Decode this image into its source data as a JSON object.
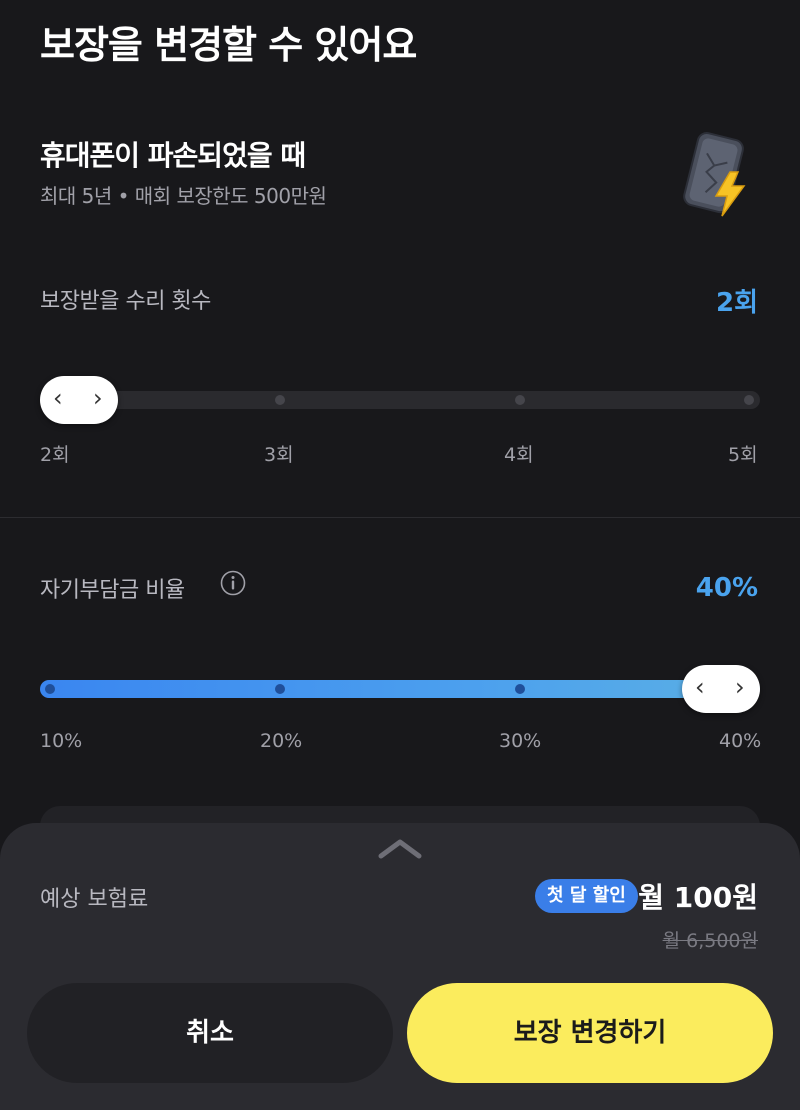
{
  "page": {
    "title": "보장을 변경할 수 있어요"
  },
  "coverage": {
    "name": "휴대폰이 파손되었을 때",
    "description": "최대 5년 • 매회 보장한도 500만원",
    "icon": "phone-damage-icon"
  },
  "repair_slider": {
    "label": "보장받을 수리 횟수",
    "value_text": "2회",
    "selected_index": 0,
    "ticks": [
      "2회",
      "3회",
      "4회",
      "5회"
    ],
    "handle_left_glyph": "‹",
    "handle_right_glyph": "›"
  },
  "deductible_slider": {
    "label": "자기부담금 비율",
    "info_icon": "info-icon",
    "value_text": "40%",
    "selected_index": 3,
    "ticks": [
      "10%",
      "20%",
      "30%",
      "40%"
    ],
    "handle_left_glyph": "‹",
    "handle_right_glyph": "›"
  },
  "sheet": {
    "expand_icon": "chevron-up-icon",
    "premium_label": "예상 보험료",
    "discount_badge": "첫 달 할인",
    "price_now": "월 100원",
    "price_old": "월 6,500원",
    "cancel_label": "취소",
    "confirm_label": "보장 변경하기"
  },
  "colors": {
    "background": "#18181b",
    "accent_blue": "#4aa3ee",
    "badge_blue": "#3a7ee8",
    "confirm_yellow": "#fbec5d",
    "sheet_bg": "#2b2b30"
  }
}
